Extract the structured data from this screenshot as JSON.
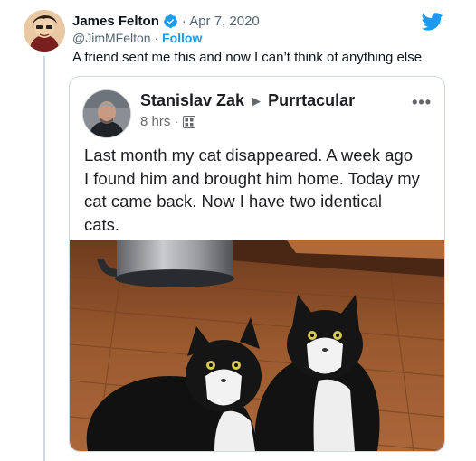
{
  "tweet": {
    "author_name": "James Felton",
    "date": "· Apr 7, 2020",
    "handle": "@JimMFelton",
    "separator": " · ",
    "follow_label": "Follow",
    "text": "A friend sent me this and now I can’t think of anything else",
    "verified_icon": "verified-badge-icon",
    "brand_icon": "twitter-bird-icon",
    "accent_color": "#1d9bf0"
  },
  "embedded_post": {
    "poster_name": "Stanislav Zak",
    "group_name": "Purrtacular",
    "arrow": "▶",
    "time": "8 hrs ·",
    "more_icon": "more-dots-icon",
    "more_label": "•••",
    "text_lines": [
      "Last month my cat disappeared.  A week ago",
      "I found him and brought him home.  Today my",
      "cat came back.  Now I have two identical",
      "cats."
    ],
    "photo_subject": "two-tuxedo-cats-photo"
  }
}
